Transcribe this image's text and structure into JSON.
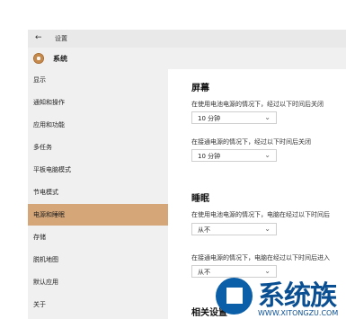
{
  "titlebar": {
    "back_icon": "←",
    "app_title": "设置"
  },
  "header": {
    "icon": "gear-icon",
    "title": "系统"
  },
  "sidebar": {
    "items": [
      {
        "label": "显示"
      },
      {
        "label": "通知和操作"
      },
      {
        "label": "应用和功能"
      },
      {
        "label": "多任务"
      },
      {
        "label": "平板电脑模式"
      },
      {
        "label": "节电模式"
      },
      {
        "label": "电源和睡眠",
        "active": true
      },
      {
        "label": "存储"
      },
      {
        "label": "脱机地图"
      },
      {
        "label": "默认应用"
      },
      {
        "label": "关于"
      }
    ]
  },
  "main": {
    "screen": {
      "heading": "屏幕",
      "battery_label": "在使用电池电源的情况下，经过以下时间后关闭",
      "battery_value": "10 分钟",
      "plugged_label": "在接通电源的情况下，经过以下时间后关闭",
      "plugged_value": "10 分钟"
    },
    "sleep": {
      "heading": "睡眠",
      "battery_label": "在使用电池电源的情况下，电脑在经过以下时间后",
      "battery_value": "从不",
      "plugged_label": "在接通电源的情况下，电脑在经过以下时间后进入",
      "plugged_value": "从不"
    },
    "related_heading": "相关设置"
  },
  "watermark": {
    "brand": "系统族",
    "url": "WWW.XITONGZU.COM"
  },
  "colors": {
    "active_item": "#d5a678",
    "brand": "#0a4f92"
  }
}
